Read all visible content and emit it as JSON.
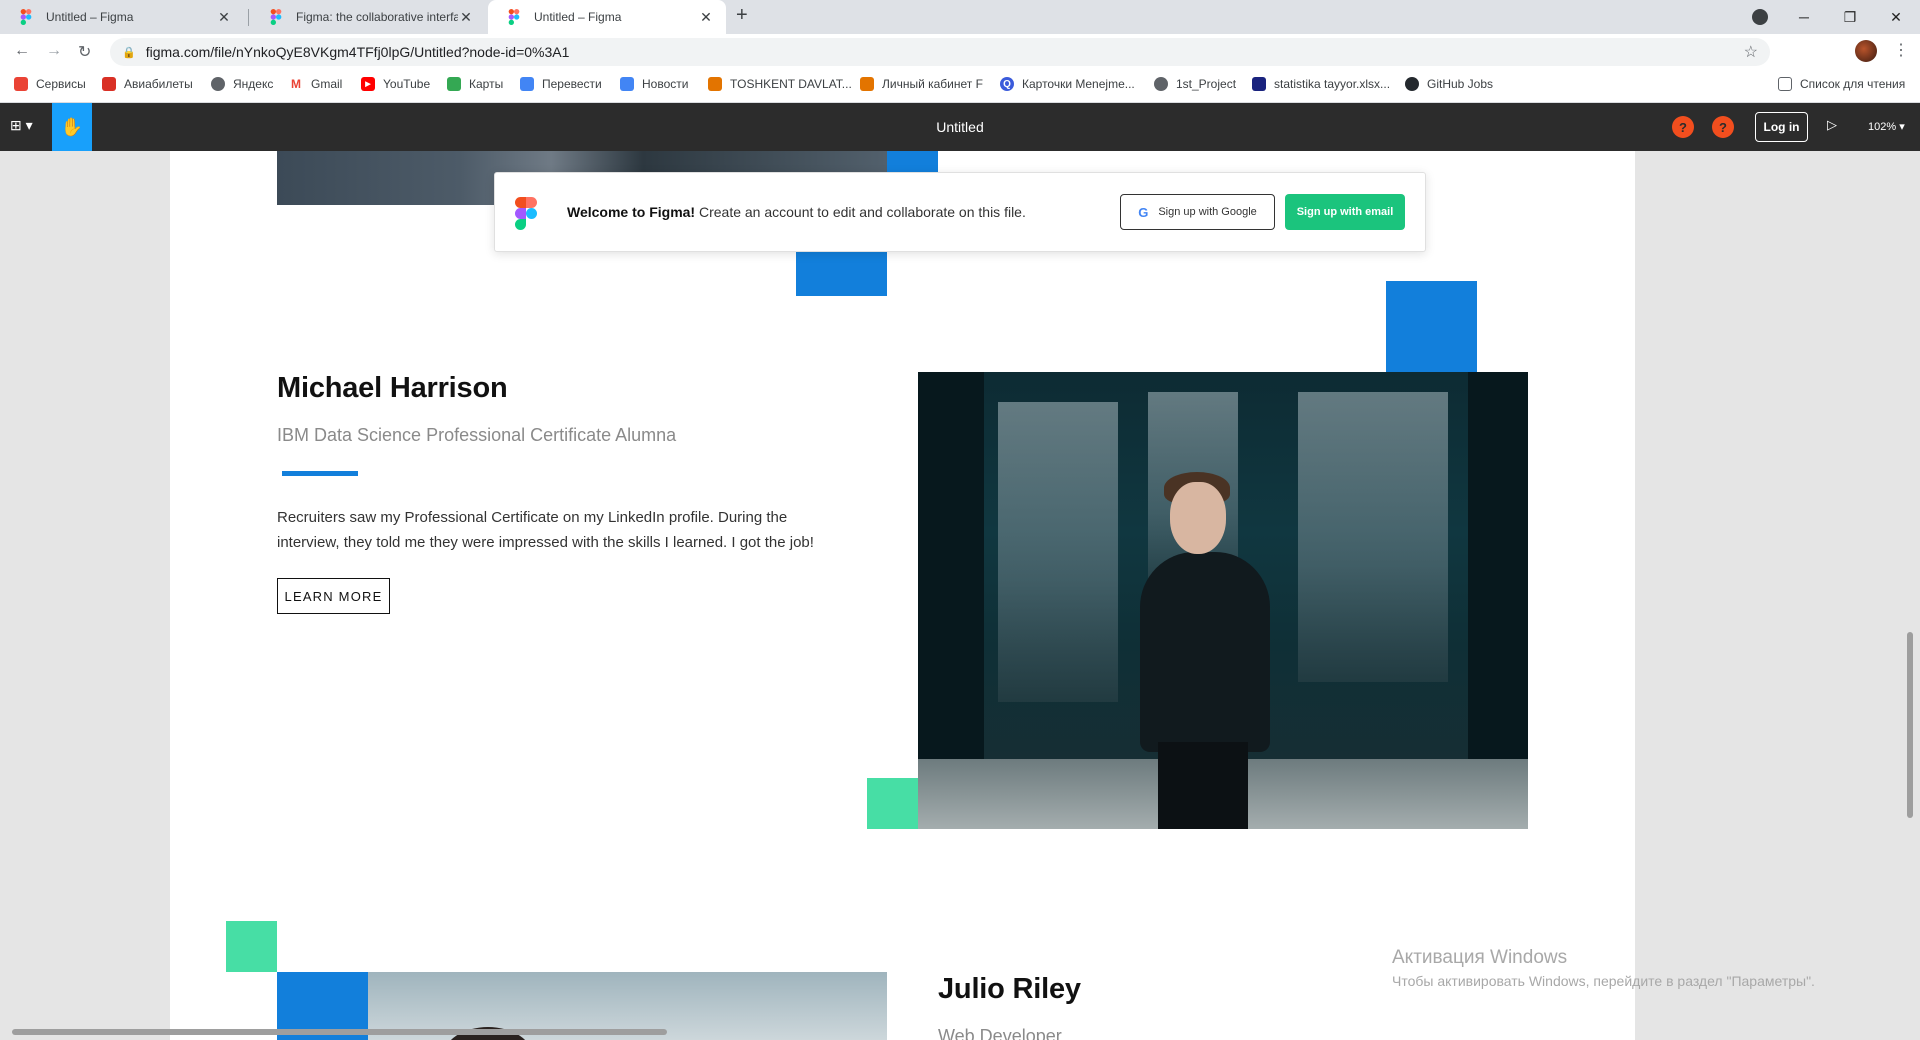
{
  "browser": {
    "tabs": [
      {
        "title": "Untitled – Figma"
      },
      {
        "title": "Figma: the collaborative interface"
      },
      {
        "title": "Untitled – Figma"
      }
    ],
    "url": "figma.com/file/nYnkoQyE8VKgm4TFfj0lpG/Untitled?node-id=0%3A1",
    "bookmarks": [
      {
        "label": "Сервисы",
        "color": "#ea4335"
      },
      {
        "label": "Авиабилеты",
        "color": "#d93025"
      },
      {
        "label": "Яндекс",
        "color": "#5f6368"
      },
      {
        "label": "Gmail",
        "color": "#ea4335"
      },
      {
        "label": "YouTube",
        "color": "#ff0000"
      },
      {
        "label": "Карты",
        "color": "#34a853"
      },
      {
        "label": "Перевести",
        "color": "#4285f4"
      },
      {
        "label": "Новости",
        "color": "#4285f4"
      },
      {
        "label": "TOSHKENT DAVLAT...",
        "color": "#e37400"
      },
      {
        "label": "Личный кабинет F",
        "color": "#e37400"
      },
      {
        "label": "Карточки Menejme...",
        "color": "#3b5bdb"
      },
      {
        "label": "1st_Project",
        "color": "#5f6368"
      },
      {
        "label": "statistika tayyor.xlsx...",
        "color": "#1a237e"
      },
      {
        "label": "GitHub Jobs",
        "color": "#24292e"
      }
    ],
    "reading_list": "Список для чтения"
  },
  "figma": {
    "title": "Untitled",
    "help": "?",
    "login": "Log in",
    "zoom": "102%"
  },
  "welcome": {
    "bold": "Welcome to Figma!",
    "text": " Create an account to edit and collaborate on this file.",
    "google_btn": "Sign up with Google",
    "email_btn": "Sign up with email"
  },
  "testimonials": [
    {
      "name": "Michael Harrison",
      "role": "IBM Data Science Professional Certificate Alumna",
      "quote_line1": "Recruiters saw my Professional Certificate on my LinkedIn profile. During the",
      "quote_line2": "interview, they told me they were impressed with the skills I learned. I got the job!",
      "cta": "LEARN MORE"
    },
    {
      "name": "Julio Riley",
      "role": "Web Developer"
    }
  ],
  "watermark": {
    "title": "Активация Windows",
    "subtitle": "Чтобы активировать Windows, перейдите в раздел \"Параметры\"."
  },
  "colors": {
    "accent_blue": "#127fdb",
    "accent_green": "#47dea5",
    "figma_bar": "#2c2c2c",
    "signup_green": "#1bc47d"
  }
}
